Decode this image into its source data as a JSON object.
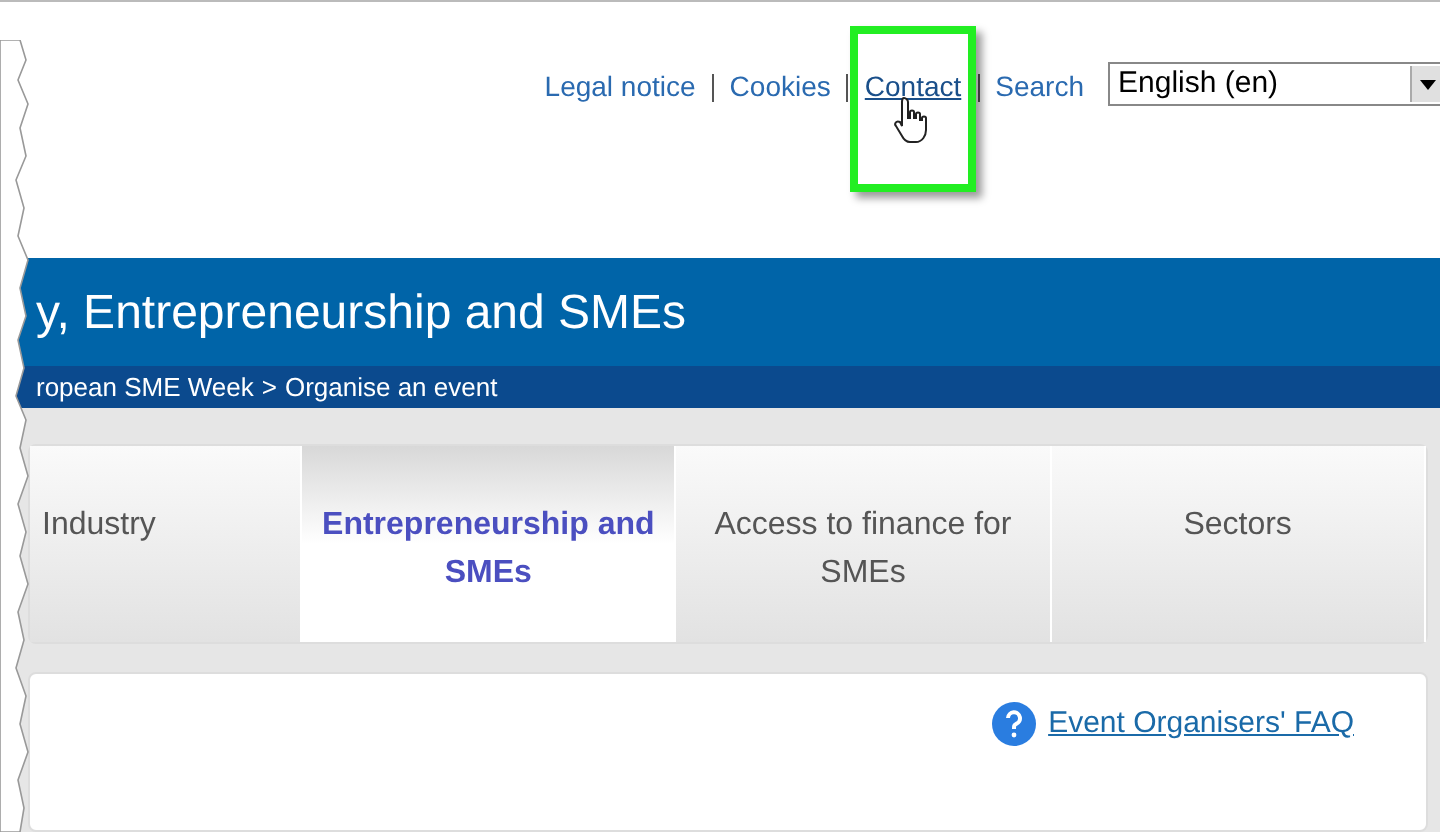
{
  "top_links": [
    {
      "label": "Legal notice",
      "hovered": false
    },
    {
      "label": "Cookies",
      "hovered": false
    },
    {
      "label": "Contact",
      "hovered": true
    },
    {
      "label": "Search",
      "hovered": false
    }
  ],
  "language_select": {
    "value": "English (en)"
  },
  "banner": {
    "title": "y, Entrepreneurship and SMEs"
  },
  "breadcrumb": [
    {
      "label": "ropean SME Week"
    },
    {
      "label": "Organise an event"
    }
  ],
  "breadcrumb_separator": ">",
  "tabs": [
    {
      "label": "Industry",
      "selected": false
    },
    {
      "label": "Entrepreneurship and SMEs",
      "selected": true
    },
    {
      "label": "Access to finance for SMEs",
      "selected": false
    },
    {
      "label": "Sectors",
      "selected": false
    }
  ],
  "faq_link": {
    "label": "Event Organisers' FAQ"
  },
  "highlight": {
    "shown": true
  }
}
